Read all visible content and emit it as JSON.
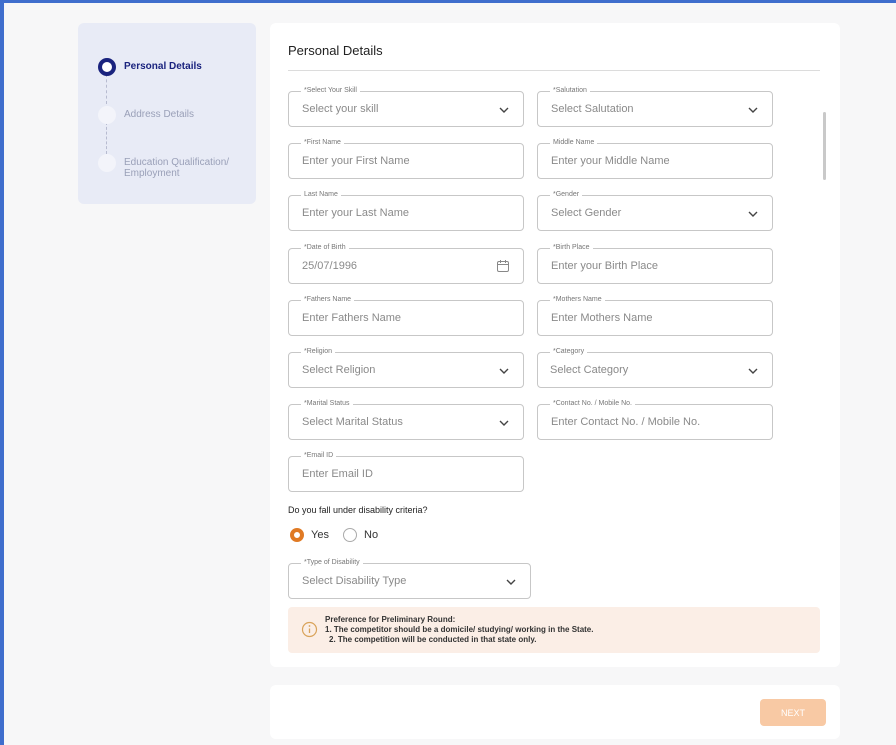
{
  "stepper": {
    "steps": [
      {
        "label": "Personal Details",
        "state": "active"
      },
      {
        "label": "Address Details",
        "state": "pending"
      },
      {
        "label": "Education Qualification/\nEmployment",
        "state": "pending"
      }
    ]
  },
  "form": {
    "title": "Personal Details",
    "fields": {
      "skill": {
        "label": "*Select Your Skill",
        "value": "Select your skill",
        "type": "select"
      },
      "salutation": {
        "label": "*Salutation",
        "value": "Select Salutation",
        "type": "select"
      },
      "first_name": {
        "label": "*First Name",
        "value": "Enter your First Name",
        "type": "text"
      },
      "middle_name": {
        "label": "Middle Name",
        "value": "Enter your Middle Name",
        "type": "text"
      },
      "last_name": {
        "label": "Last Name",
        "value": "Enter your Last Name",
        "type": "text"
      },
      "gender": {
        "label": "*Gender",
        "value": "Select Gender",
        "type": "select"
      },
      "dob": {
        "label": "*Date of Birth",
        "value": "25/07/1996",
        "type": "date"
      },
      "birth_place": {
        "label": "*Birth Place",
        "value": "Enter your Birth Place",
        "type": "text"
      },
      "fathers_name": {
        "label": "*Fathers Name",
        "value": "Enter Fathers Name",
        "type": "text"
      },
      "mothers_name": {
        "label": "*Mothers Name",
        "value": "Enter Mothers Name",
        "type": "text"
      },
      "religion": {
        "label": "*Religion",
        "value": "Select Religion",
        "type": "select"
      },
      "category": {
        "label": "*Category",
        "value": "Select Category",
        "type": "select"
      },
      "marital_status": {
        "label": "*Marital Status",
        "value": "Select Marital Status",
        "type": "select"
      },
      "contact": {
        "label": "*Contact No. / Mobile No.",
        "value": "Enter Contact No. / Mobile No.",
        "type": "text"
      },
      "email": {
        "label": "*Email ID",
        "value": "Enter Email ID",
        "type": "text"
      },
      "disability_type": {
        "label": "*Type of Disability",
        "value": "Select Disability Type",
        "type": "select"
      }
    },
    "disability_question": "Do you fall under disability criteria?",
    "disability_options": {
      "yes": "Yes",
      "no": "No",
      "selected": "yes"
    },
    "notice": {
      "title": "Preference for Preliminary Round:",
      "line1": "1. The competitor should be a domicile/ studying/ working in the State.",
      "line2": "2. The competition will be conducted in that state only."
    },
    "next_label": "NEXT"
  },
  "colors": {
    "accent": "#1a237e",
    "radio": "#e07a24",
    "next_button": "#f8c9a4",
    "notice_bg": "#fbeee6",
    "frame": "#3f6ecd"
  },
  "icons": {
    "select": "chevron-down-icon",
    "date": "calendar-icon",
    "notice": "info-icon"
  }
}
